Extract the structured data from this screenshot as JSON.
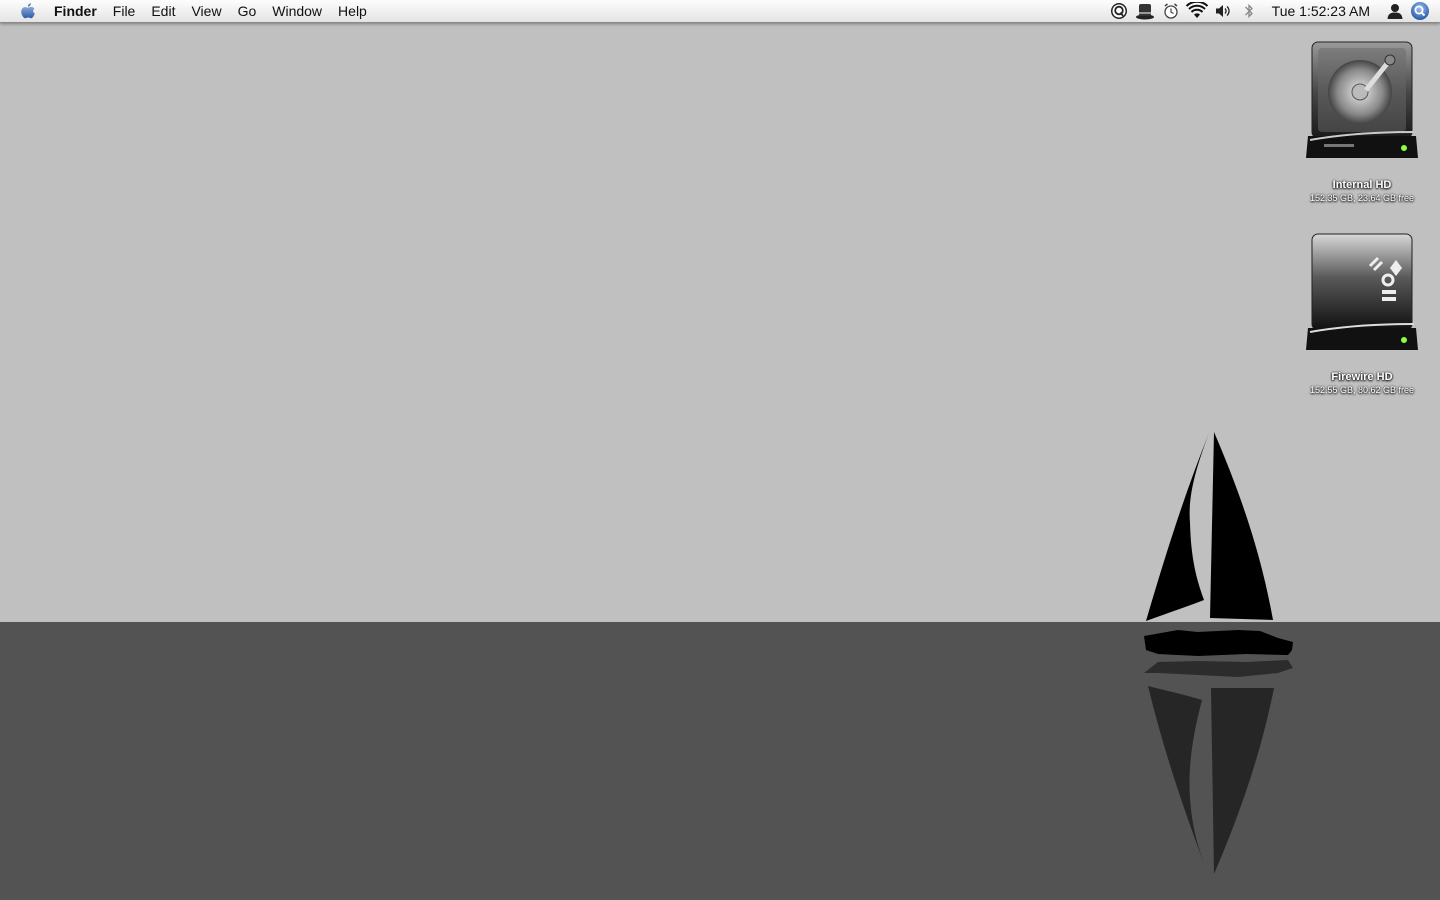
{
  "menubar": {
    "apple_icon": "apple-icon",
    "app_name": "Finder",
    "items": [
      "File",
      "Edit",
      "View",
      "Go",
      "Window",
      "Help"
    ],
    "status_icons": [
      "quicksilver-icon",
      "top-hat-icon",
      "alarm-clock-icon",
      "wifi-icon",
      "volume-icon",
      "bluetooth-icon"
    ],
    "clock": "Tue 1:52:23 AM",
    "user_icon": "user-icon",
    "spotlight_icon": "spotlight-icon"
  },
  "desktop": {
    "icons": [
      {
        "name": "Internal HD",
        "info": "152.35 GB, 23.64 GB free",
        "icon": "hard-drive-icon"
      },
      {
        "name": "Firewire HD",
        "info": "152.55 GB, 80.62 GB free",
        "icon": "firewire-drive-icon"
      }
    ]
  },
  "wallpaper": {
    "sky_color": "#c0c0c0",
    "sea_color": "#535353",
    "motif": "sailboat-silhouette"
  }
}
